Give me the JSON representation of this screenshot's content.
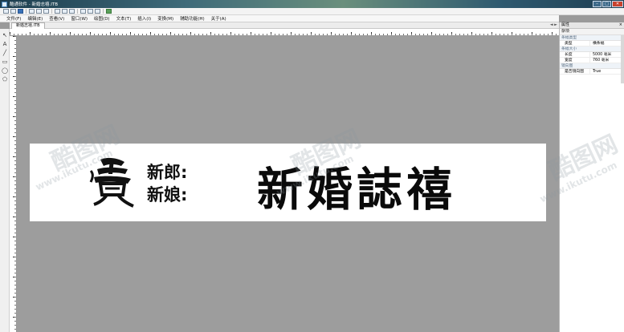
{
  "window": {
    "title": "酷通软件 - 新婚志禧.ITB",
    "buttons": {
      "minimize": "–",
      "maximize": "□",
      "close": "✕"
    }
  },
  "menu": [
    "文件(F)",
    "编辑(E)",
    "查看(V)",
    "窗口(W)",
    "绘图(D)",
    "文本(T)",
    "插入(I)",
    "变换(M)",
    "辅助功能(H)",
    "关于(A)"
  ],
  "tab": {
    "label": "新婚志禧.ITB",
    "arrows": "◄ ►"
  },
  "tools": [
    "pointer",
    "text",
    "line",
    "rectangle",
    "ellipse",
    "polygon"
  ],
  "canvas": {
    "groom_label": "新郎:",
    "bride_label": "新娘:",
    "headline": "新婚誌禧",
    "calligraphy_char": "賀"
  },
  "panel": {
    "title": "属性",
    "close": "×",
    "subtitle": "杂项",
    "groups": [
      {
        "name": "条幅类型",
        "rows": [
          {
            "key": "类型",
            "value": "横条幅"
          }
        ]
      },
      {
        "name": "条幅大小",
        "rows": [
          {
            "key": "长度",
            "value": "5000    毫米"
          },
          {
            "key": "宽度",
            "value": "760    毫米"
          }
        ]
      },
      {
        "name": "镜向图",
        "rows": [
          {
            "key": "是否镜向图",
            "value": "True"
          }
        ]
      }
    ]
  },
  "watermark": {
    "logo": "酷图网",
    "url": "www.ikutu.com"
  },
  "colors": {
    "canvas_bg": "#9d9d9d",
    "banner_bg": "#ffffff",
    "text": "#111111"
  }
}
